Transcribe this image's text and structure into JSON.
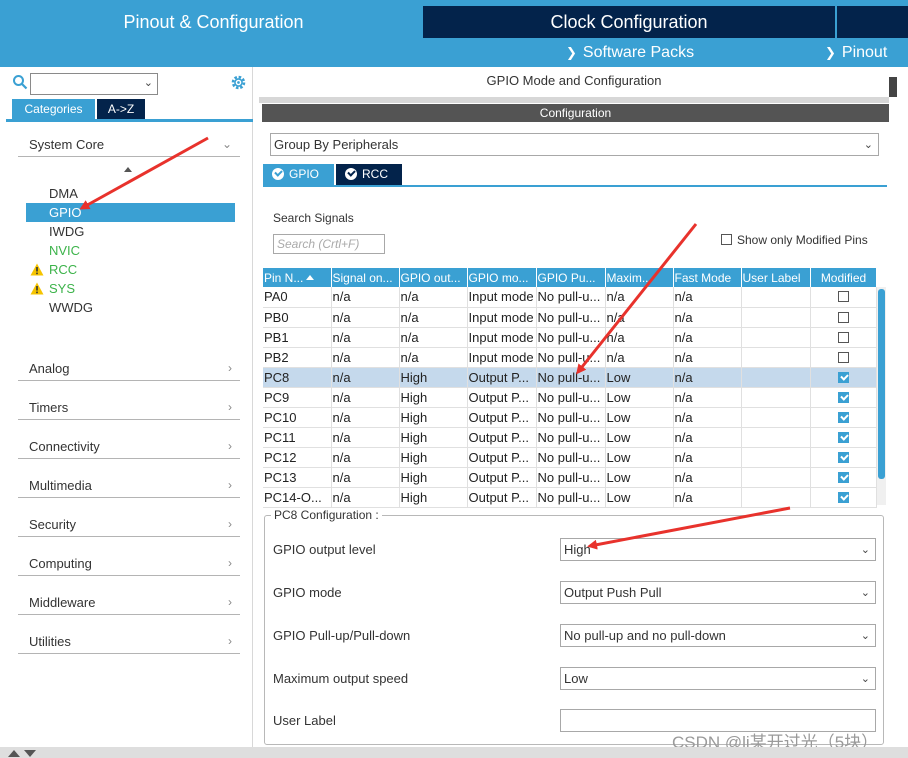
{
  "top_tabs": {
    "pinout": "Pinout & Configuration",
    "clock": "Clock Configuration"
  },
  "sub_menu": {
    "software_packs": "Software Packs",
    "pinout": "Pinout"
  },
  "left_panel": {
    "category_tabs": [
      "Categories",
      "A->Z"
    ],
    "categories": [
      {
        "label": "System Core",
        "expanded": true
      },
      {
        "label": "Analog"
      },
      {
        "label": "Timers"
      },
      {
        "label": "Connectivity"
      },
      {
        "label": "Multimedia"
      },
      {
        "label": "Security"
      },
      {
        "label": "Computing"
      },
      {
        "label": "Middleware"
      },
      {
        "label": "Utilities"
      }
    ],
    "system_core_items": [
      {
        "label": "DMA",
        "state": "normal"
      },
      {
        "label": "GPIO",
        "state": "selected"
      },
      {
        "label": "IWDG",
        "state": "normal"
      },
      {
        "label": "NVIC",
        "state": "green"
      },
      {
        "label": "RCC",
        "state": "warning"
      },
      {
        "label": "SYS",
        "state": "warning"
      },
      {
        "label": "WWDG",
        "state": "normal"
      }
    ]
  },
  "right_panel": {
    "header": "GPIO Mode and Configuration",
    "configuration_label": "Configuration",
    "group_by": "Group By Peripherals",
    "peripheral_tabs": [
      "GPIO",
      "RCC"
    ],
    "search_signals_label": "Search Signals",
    "search_placeholder": "Search (Crtl+F)",
    "show_modified_label": "Show only Modified Pins",
    "table": {
      "columns": [
        "Pin N...",
        "Signal on...",
        "GPIO out...",
        "GPIO mo...",
        "GPIO Pu...",
        "Maxim...",
        "Fast Mode",
        "User Label",
        "Modified"
      ],
      "rows": [
        {
          "pin": "PA0",
          "signal": "n/a",
          "out": "n/a",
          "mode": "Input mode",
          "pull": "No pull-u...",
          "max": "n/a",
          "fast": "n/a",
          "label": "",
          "modified": false
        },
        {
          "pin": "PB0",
          "signal": "n/a",
          "out": "n/a",
          "mode": "Input mode",
          "pull": "No pull-u...",
          "max": "n/a",
          "fast": "n/a",
          "label": "",
          "modified": false
        },
        {
          "pin": "PB1",
          "signal": "n/a",
          "out": "n/a",
          "mode": "Input mode",
          "pull": "No pull-u...",
          "max": "n/a",
          "fast": "n/a",
          "label": "",
          "modified": false
        },
        {
          "pin": "PB2",
          "signal": "n/a",
          "out": "n/a",
          "mode": "Input mode",
          "pull": "No pull-u...",
          "max": "n/a",
          "fast": "n/a",
          "label": "",
          "modified": false
        },
        {
          "pin": "PC8",
          "signal": "n/a",
          "out": "High",
          "mode": "Output P...",
          "pull": "No pull-u...",
          "max": "Low",
          "fast": "n/a",
          "label": "",
          "modified": true,
          "selected": true
        },
        {
          "pin": "PC9",
          "signal": "n/a",
          "out": "High",
          "mode": "Output P...",
          "pull": "No pull-u...",
          "max": "Low",
          "fast": "n/a",
          "label": "",
          "modified": true
        },
        {
          "pin": "PC10",
          "signal": "n/a",
          "out": "High",
          "mode": "Output P...",
          "pull": "No pull-u...",
          "max": "Low",
          "fast": "n/a",
          "label": "",
          "modified": true
        },
        {
          "pin": "PC11",
          "signal": "n/a",
          "out": "High",
          "mode": "Output P...",
          "pull": "No pull-u...",
          "max": "Low",
          "fast": "n/a",
          "label": "",
          "modified": true
        },
        {
          "pin": "PC12",
          "signal": "n/a",
          "out": "High",
          "mode": "Output P...",
          "pull": "No pull-u...",
          "max": "Low",
          "fast": "n/a",
          "label": "",
          "modified": true
        },
        {
          "pin": "PC13",
          "signal": "n/a",
          "out": "High",
          "mode": "Output P...",
          "pull": "No pull-u...",
          "max": "Low",
          "fast": "n/a",
          "label": "",
          "modified": true
        },
        {
          "pin": "PC14-O...",
          "signal": "n/a",
          "out": "High",
          "mode": "Output P...",
          "pull": "No pull-u...",
          "max": "Low",
          "fast": "n/a",
          "label": "",
          "modified": true
        }
      ]
    },
    "pin_config": {
      "title": "PC8 Configuration :",
      "fields": [
        {
          "label": "GPIO output level",
          "value": "High"
        },
        {
          "label": "GPIO mode",
          "value": "Output Push Pull"
        },
        {
          "label": "GPIO Pull-up/Pull-down",
          "value": "No pull-up and no pull-down"
        },
        {
          "label": "Maximum output speed",
          "value": "Low"
        },
        {
          "label": "User Label",
          "value": ""
        }
      ]
    }
  },
  "watermark": "CSDN @li某开过光（5块）",
  "colors": {
    "accent": "#3aa0d3",
    "dark_tab": "#03234b",
    "selected_row": "#c5d9ec",
    "config_bar": "#545454",
    "green_item": "#3cb34a",
    "warning": "#f5c400",
    "annotation_arrow": "#e8322c"
  }
}
